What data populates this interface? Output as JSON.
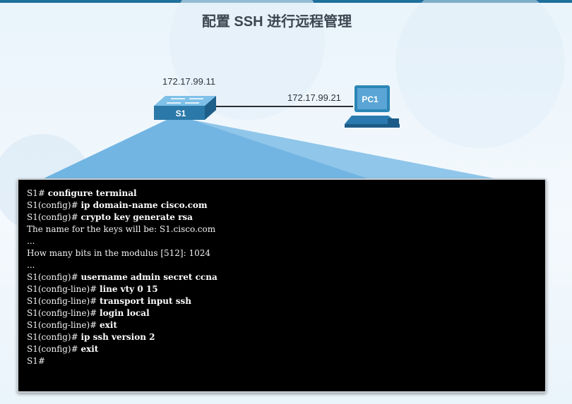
{
  "title": "配置 SSH 进行远程管理",
  "devices": {
    "switch": {
      "label": "S1",
      "ip": "172.17.99.11"
    },
    "pc": {
      "label": "PC1",
      "ip": "172.17.99.21"
    }
  },
  "colors": {
    "header_bar": "#1f6f9d",
    "switch": "#2b79a8",
    "pc": "#2b86b6",
    "beam": "#6fb4e2",
    "terminal_bg": "#000000",
    "terminal_text": "#f2f2f2"
  },
  "terminal": {
    "lines": [
      {
        "prompt": "S1# ",
        "cmd": "configure terminal"
      },
      {
        "prompt": "S1(config)# ",
        "cmd": "ip domain-name cisco.com"
      },
      {
        "prompt": "S1(config)# ",
        "cmd": "crypto key generate rsa"
      },
      {
        "prompt": "The name for the keys will be: S1.cisco.com",
        "cmd": ""
      },
      {
        "prompt": "...",
        "cmd": ""
      },
      {
        "prompt": "How many bits in the modulus [512]: 1024",
        "cmd": ""
      },
      {
        "prompt": "...",
        "cmd": ""
      },
      {
        "prompt": "S1(config)# ",
        "cmd": "username admin secret ccna"
      },
      {
        "prompt": "S1(config-line)# ",
        "cmd": "line vty 0 15"
      },
      {
        "prompt": "S1(config-line)# ",
        "cmd": "transport input ssh"
      },
      {
        "prompt": "S1(config-line)# ",
        "cmd": "login local"
      },
      {
        "prompt": "S1(config-line)# ",
        "cmd": "exit"
      },
      {
        "prompt": "S1(config)# ",
        "cmd": "ip ssh version 2"
      },
      {
        "prompt": "S1(config)# ",
        "cmd": "exit"
      },
      {
        "prompt": "S1#",
        "cmd": ""
      }
    ]
  }
}
